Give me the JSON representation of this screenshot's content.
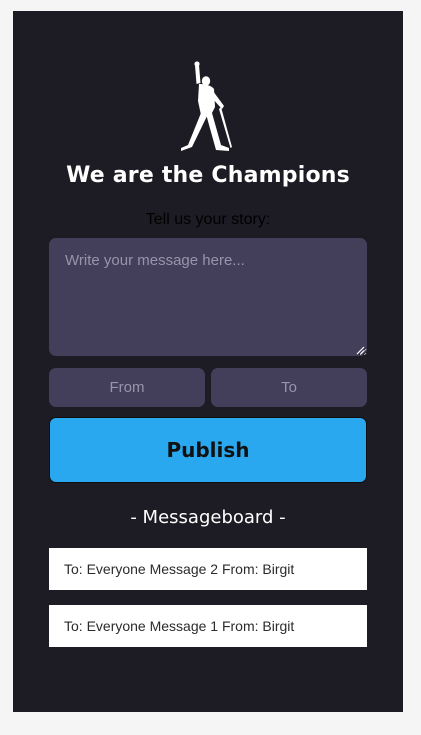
{
  "header": {
    "logo_icon": "freddie-mercury-silhouette-icon",
    "title": "We are the Champions",
    "subtitle": "Tell us your story:"
  },
  "form": {
    "message_placeholder": "Write your message here...",
    "from_placeholder": "From",
    "to_placeholder": "To",
    "publish_label": "Publish"
  },
  "messageboard": {
    "heading": "- Messageboard -",
    "items": [
      "To: Everyone Message 2 From: Birgit",
      "To: Everyone Message 1 From: Birgit"
    ]
  },
  "colors": {
    "page_bg": "#f5f5f5",
    "app_bg": "#1d1b23",
    "input_bg": "#433f5b",
    "publish_bg": "#29a8ef",
    "message_item_bg": "#ffffff"
  }
}
